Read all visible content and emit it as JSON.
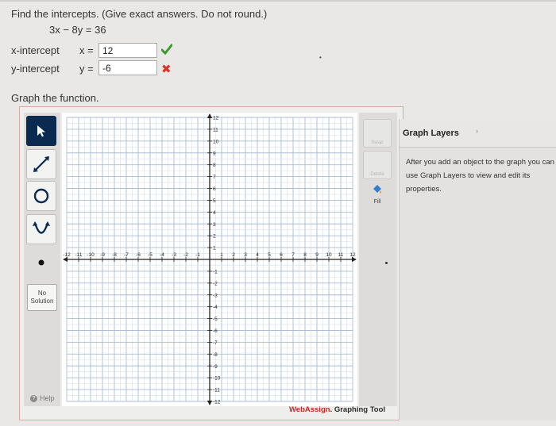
{
  "question": {
    "instructions": "Find the intercepts. (Give exact answers. Do not round.)",
    "equation": "3x − 8y = 36",
    "x_intercept": {
      "label": "x-intercept",
      "prefix": "x =",
      "value": "12",
      "status": "correct"
    },
    "y_intercept": {
      "label": "y-intercept",
      "prefix": "y =",
      "value": "-6",
      "status": "incorrect"
    },
    "graph_prompt": "Graph the function."
  },
  "toolbar": {
    "tools": [
      {
        "name": "pointer-tool",
        "icon": "pointer-arrow-icon",
        "active": true
      },
      {
        "name": "line-tool",
        "icon": "line-icon",
        "active": false
      },
      {
        "name": "circle-tool",
        "icon": "circle-icon",
        "active": false
      },
      {
        "name": "parabola-tool",
        "icon": "parabola-icon",
        "active": false
      },
      {
        "name": "point-tool",
        "icon": "point-icon",
        "active": false
      }
    ],
    "no_solution_label": "No Solution",
    "help_label": "Help"
  },
  "side_tools": {
    "swap_label": "Swap",
    "delete_label": "Delete",
    "fill_label": "Fill"
  },
  "chart_data": {
    "type": "scatter",
    "title": "",
    "xlabel": "",
    "ylabel": "",
    "xlim": [
      -12,
      12
    ],
    "ylim": [
      -12,
      12
    ],
    "x_ticks": [
      -12,
      -11,
      -10,
      -9,
      -8,
      -7,
      -6,
      -5,
      -4,
      -3,
      -2,
      -1,
      1,
      2,
      3,
      4,
      5,
      6,
      7,
      8,
      9,
      10,
      11,
      12
    ],
    "y_ticks": [
      12,
      11,
      10,
      9,
      8,
      7,
      6,
      5,
      4,
      3,
      2,
      1,
      -1,
      -2,
      -3,
      -4,
      -5,
      -6,
      -7,
      -8,
      -9,
      -10,
      -11,
      -12
    ],
    "grid": true,
    "series": []
  },
  "graph_layers": {
    "title": "Graph Layers",
    "help_text": "After you add an object to the graph you can use Graph Layers to view and edit its properties."
  },
  "branding": {
    "web": "WebAssign",
    "rest": ". Graphing Tool"
  },
  "colors": {
    "correct": "#3d9a2f",
    "incorrect": "#d9362b",
    "active_tool": "#0b2a4f",
    "brand": "#c8261d"
  }
}
